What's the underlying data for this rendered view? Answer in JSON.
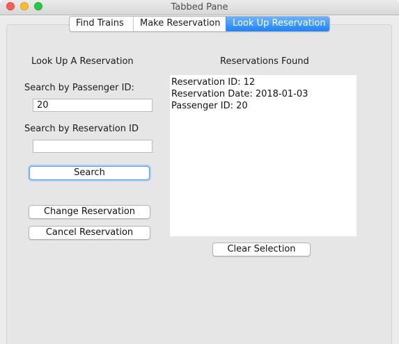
{
  "window": {
    "title": "Tabbed Pane"
  },
  "tabs": [
    {
      "label": "Find Trains"
    },
    {
      "label": "Make Reservation"
    },
    {
      "label": "Look Up Reservation"
    }
  ],
  "lookup": {
    "heading": "Look Up A Reservation",
    "passenger_label": "Search by Passenger ID:",
    "passenger_value": "20",
    "reservation_label": "Search by Reservation ID",
    "reservation_value": "",
    "search_button": "Search",
    "change_button": "Change Reservation",
    "cancel_button": "Cancel Reservation"
  },
  "results": {
    "heading": "Reservations Found",
    "lines": [
      "Reservation ID: 12",
      "Reservation Date: 2018-01-03",
      "Passenger ID: 20"
    ],
    "clear_button": "Clear Selection"
  }
}
